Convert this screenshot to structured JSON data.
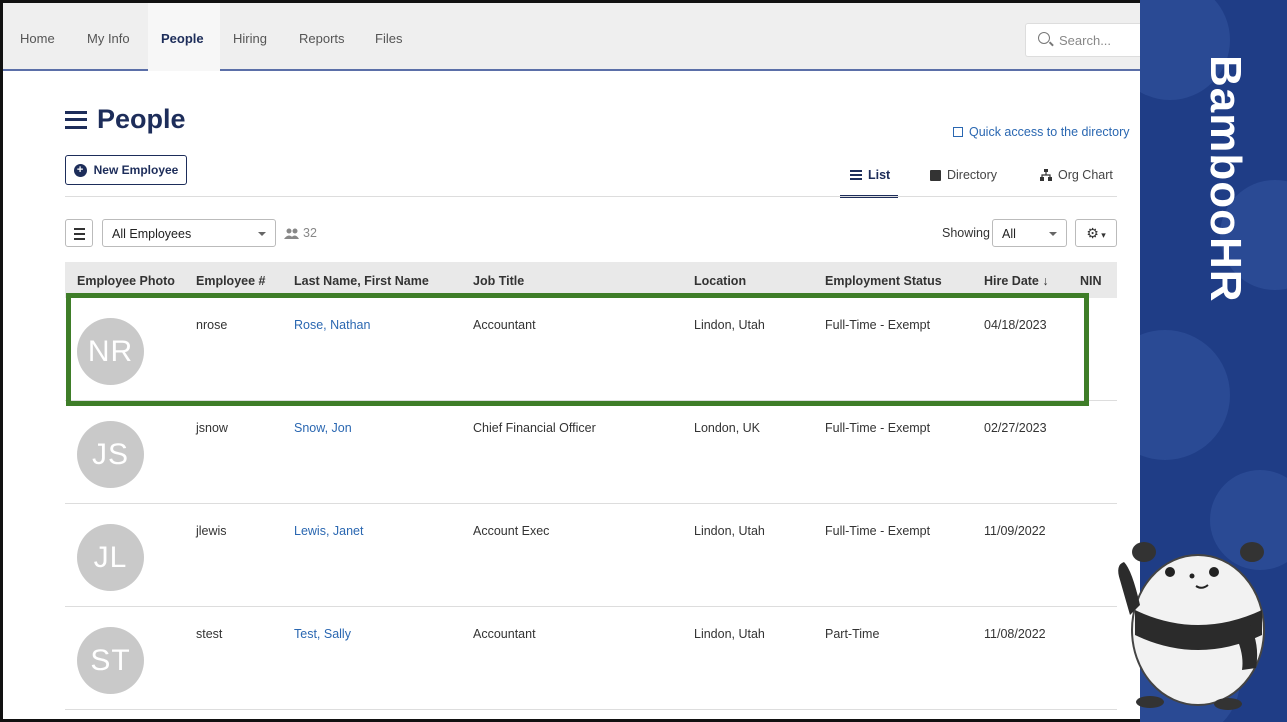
{
  "nav": {
    "items": [
      "Home",
      "My Info",
      "People",
      "Hiring",
      "Reports",
      "Files"
    ],
    "active": "People",
    "search_placeholder": "Search..."
  },
  "brand": {
    "text": "BambooHR",
    "color": "#1f3d86"
  },
  "page": {
    "title": "People",
    "quick_access": "Quick access to the directory",
    "new_employee": "New Employee",
    "view_tabs": {
      "list": "List",
      "directory": "Directory",
      "org_chart": "Org Chart"
    },
    "active_view": "List"
  },
  "filters": {
    "employee_filter": "All Employees",
    "employee_count": "32",
    "showing_label": "Showing",
    "showing_value": "All"
  },
  "table": {
    "columns": [
      "Employee Photo",
      "Employee #",
      "Last Name, First Name",
      "Job Title",
      "Location",
      "Employment Status",
      "Hire Date ↓",
      "NIN"
    ],
    "rows": [
      {
        "initials": "NR",
        "id": "nrose",
        "name": "Rose, Nathan",
        "title": "Accountant",
        "location": "Lindon, Utah",
        "status": "Full-Time - Exempt",
        "hire": "04/18/2023",
        "highlighted": true
      },
      {
        "initials": "JS",
        "id": "jsnow",
        "name": "Snow, Jon",
        "title": "Chief Financial Officer",
        "location": "London, UK",
        "status": "Full-Time - Exempt",
        "hire": "02/27/2023"
      },
      {
        "initials": "JL",
        "id": "jlewis",
        "name": "Lewis, Janet",
        "title": "Account Exec",
        "location": "Lindon, Utah",
        "status": "Full-Time - Exempt",
        "hire": "11/09/2022"
      },
      {
        "initials": "ST",
        "id": "stest",
        "name": "Test, Sally",
        "title": "Accountant",
        "location": "Lindon, Utah",
        "status": "Part-Time",
        "hire": "11/08/2022"
      }
    ]
  },
  "colors": {
    "accent": "#1d2d5a",
    "link": "#2a67b1",
    "highlight": "#3e7d28"
  }
}
